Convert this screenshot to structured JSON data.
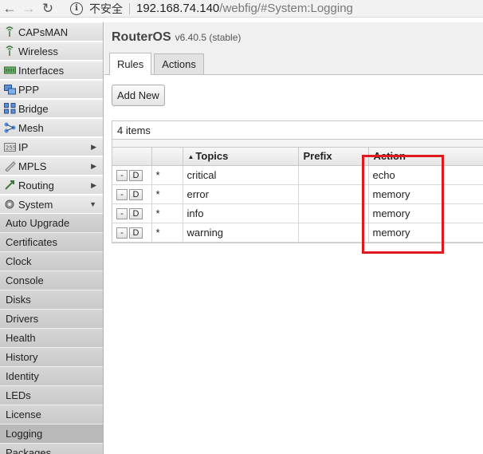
{
  "browser": {
    "security_label": "不安全",
    "url_host": "192.168.74.140",
    "url_path": "/webfig/#System:Logging"
  },
  "sidebar": {
    "items": [
      {
        "label": "CAPsMAN",
        "icon": "capsman-icon",
        "arrow": ""
      },
      {
        "label": "Wireless",
        "icon": "wireless-icon",
        "arrow": ""
      },
      {
        "label": "Interfaces",
        "icon": "interfaces-icon",
        "arrow": ""
      },
      {
        "label": "PPP",
        "icon": "ppp-icon",
        "arrow": ""
      },
      {
        "label": "Bridge",
        "icon": "bridge-icon",
        "arrow": ""
      },
      {
        "label": "Mesh",
        "icon": "mesh-icon",
        "arrow": ""
      },
      {
        "label": "IP",
        "icon": "ip-icon",
        "arrow": "▶"
      },
      {
        "label": "MPLS",
        "icon": "mpls-icon",
        "arrow": "▶"
      },
      {
        "label": "Routing",
        "icon": "routing-icon",
        "arrow": "▶"
      },
      {
        "label": "System",
        "icon": "system-icon",
        "arrow": "▼"
      }
    ],
    "subitems": [
      {
        "label": "Auto Upgrade",
        "selected": false
      },
      {
        "label": "Certificates",
        "selected": false
      },
      {
        "label": "Clock",
        "selected": false
      },
      {
        "label": "Console",
        "selected": false
      },
      {
        "label": "Disks",
        "selected": false
      },
      {
        "label": "Drivers",
        "selected": false
      },
      {
        "label": "Health",
        "selected": false
      },
      {
        "label": "History",
        "selected": false
      },
      {
        "label": "Identity",
        "selected": false
      },
      {
        "label": "LEDs",
        "selected": false
      },
      {
        "label": "License",
        "selected": false
      },
      {
        "label": "Logging",
        "selected": true
      },
      {
        "label": "Packages",
        "selected": false
      }
    ]
  },
  "header": {
    "product": "RouterOS",
    "version": "v6.40.5 (stable)"
  },
  "tabs": [
    {
      "label": "Rules",
      "active": true
    },
    {
      "label": "Actions",
      "active": false
    }
  ],
  "toolbar": {
    "add_new_label": "Add New"
  },
  "table": {
    "count_text": "4 items",
    "columns": [
      "",
      "",
      "Topics",
      "Prefix",
      "Action"
    ],
    "row_buttons": {
      "remove": "-",
      "disable": "D"
    },
    "rows": [
      {
        "flag": "*",
        "topics": "critical",
        "prefix": "",
        "action": "echo"
      },
      {
        "flag": "*",
        "topics": "error",
        "prefix": "",
        "action": "memory"
      },
      {
        "flag": "*",
        "topics": "info",
        "prefix": "",
        "action": "memory"
      },
      {
        "flag": "*",
        "topics": "warning",
        "prefix": "",
        "action": "memory"
      }
    ]
  },
  "colors": {
    "highlight": "#e0191f"
  }
}
